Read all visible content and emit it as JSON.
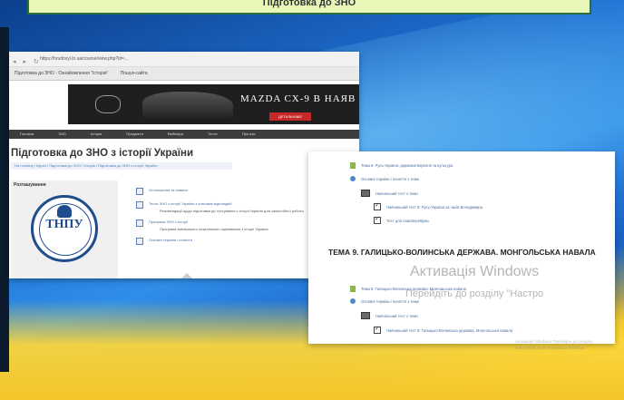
{
  "desktop": {
    "top_banner": "Підготовка до ЗНО"
  },
  "browser": {
    "url": "https://hrudovyi.in.ua/course/view.php?id=...",
    "tab_title": "Підготовка до ЗНО - Ознайомлення \"Історія\"",
    "tab_second": "Пошук-сайта",
    "ad": {
      "brand": "MAZDA",
      "headline": "MAZDA CX-9 В НАЯВ",
      "button": "ДЕТАЛЬНІШЕ"
    },
    "menu": [
      "Головна",
      "ЗНО",
      "Історія",
      "Предмети",
      "Вебінари",
      "Тести",
      "Про нас"
    ],
    "page_title": "Підготовка до ЗНО з історії України",
    "breadcrumb": "На головну / Курси / Підготовка до ЗНО / Історія / Підготовка до ЗНО з історії України",
    "left_block": {
      "title": "Розташування",
      "logo_text": "ТНПУ"
    },
    "items": [
      {
        "label": "Оголошення та новини",
        "sub": ""
      },
      {
        "label": "Тести ЗНО з історії України з ключами відповідей",
        "sub": "Рекомендації щодо підготовки до тестування з історії України для самостійної роботи"
      },
      {
        "label": "Програма ЗНО з історії",
        "sub": "Програма зовнішнього незалежного оцінювання з історії України"
      },
      {
        "label": "Основні терміни і поняття",
        "sub": ""
      }
    ]
  },
  "window2": {
    "rows_top": [
      {
        "icon": "book",
        "text": "Тема 8. Русь-Україна: державотворення та культура"
      },
      {
        "icon": "link",
        "text": "Основні терміни і поняття з теми"
      },
      {
        "icon": "folder",
        "text": "Навчальний тест з теми"
      },
      {
        "icon": "check",
        "text": "Навчальний тест 8: Русь-Україна за часів Володимира"
      },
      {
        "icon": "check",
        "text": "Тест для самоперевірки"
      }
    ],
    "topic_title": "ТЕМА 9. ГАЛИЦЬКО-ВОЛИНСЬКА ДЕРЖАВА. МОНГОЛЬСЬКА НАВАЛА",
    "rows_bottom": [
      {
        "icon": "book",
        "text": "Тема 9. Галицько-Волинська держава. Монгольська навала"
      },
      {
        "icon": "link",
        "text": "Основні терміни і поняття з теми"
      },
      {
        "icon": "folder",
        "text": "Навчальний тест з теми"
      },
      {
        "icon": "check",
        "text": "Навчальний тест 9: Галицько-Волинська держава. Монгольська навала"
      }
    ]
  },
  "activation": {
    "title": "Активація Windows",
    "subtitle": "Перейдіть до розділу \"Настро",
    "small": "Активація Windows Перейдіть до розділу Настройки, щоб активувати Windows."
  }
}
